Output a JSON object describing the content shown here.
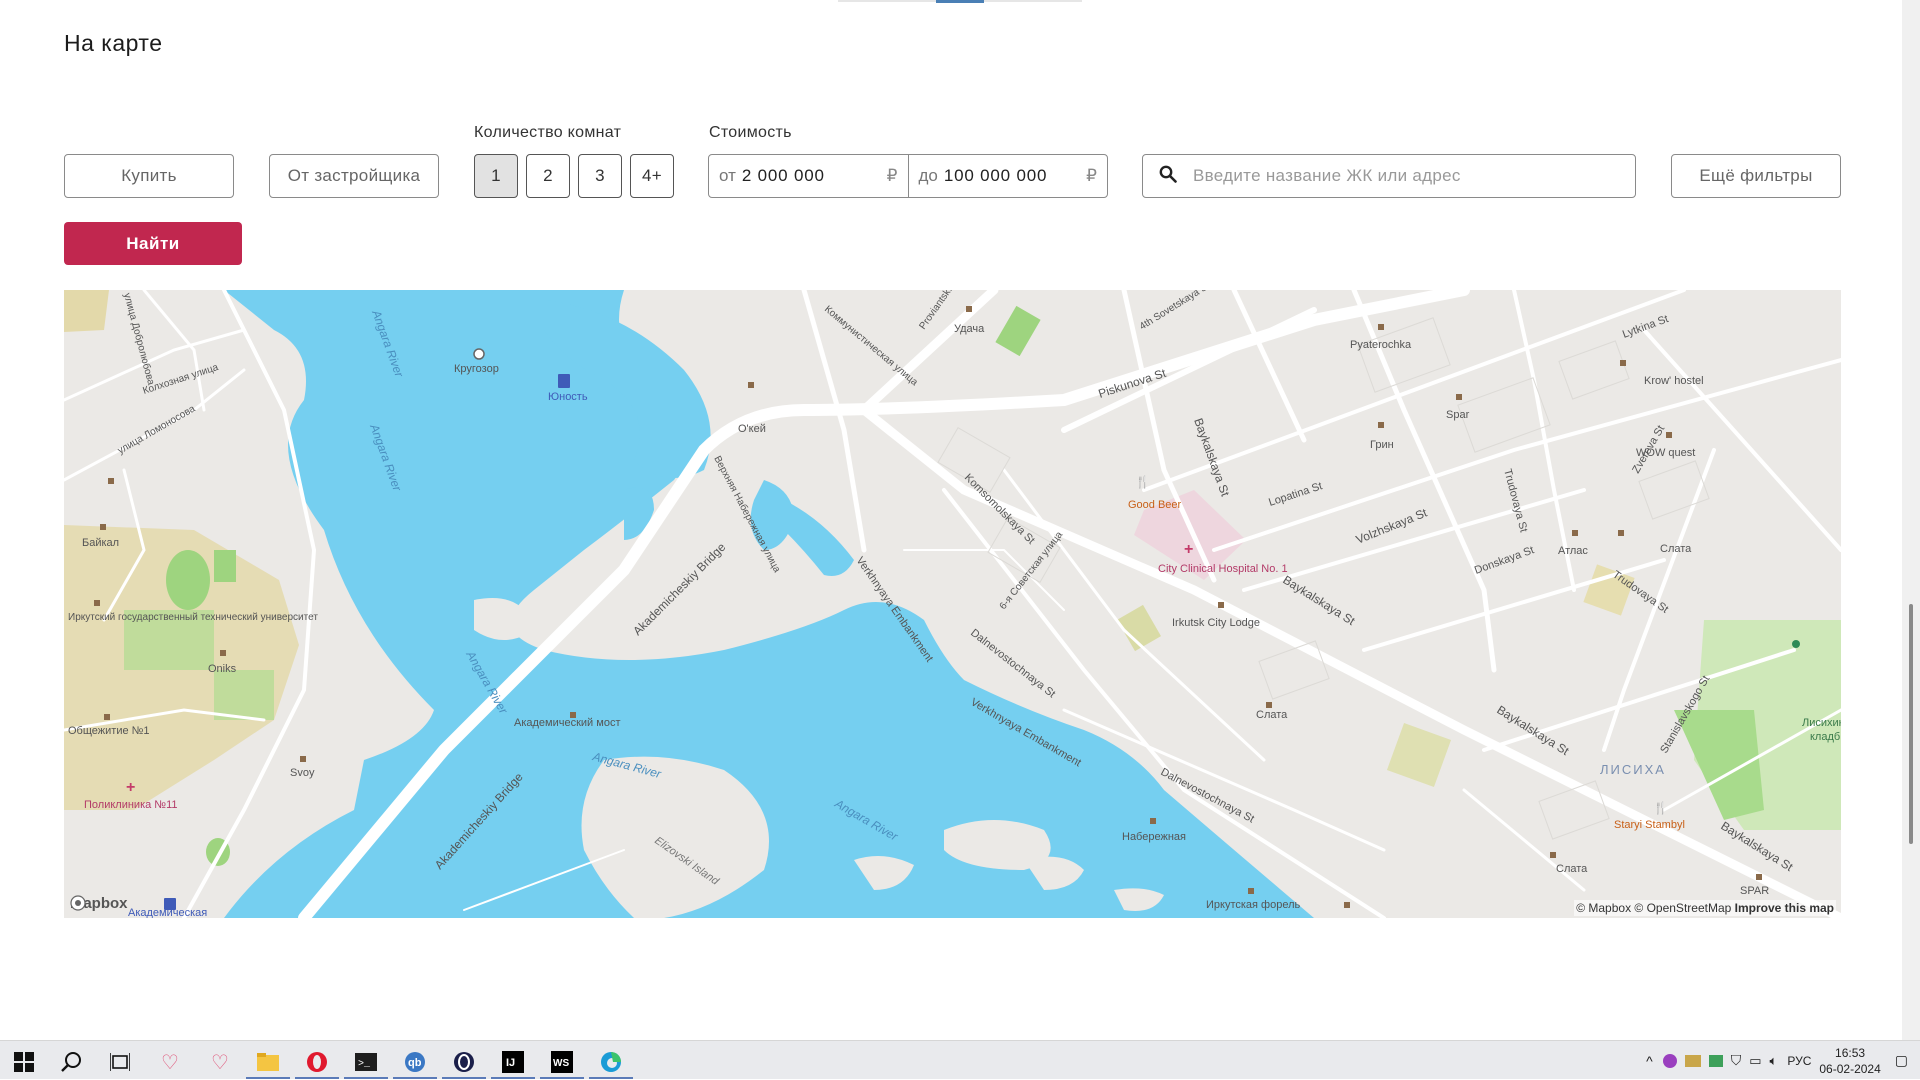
{
  "section_title": "На карте",
  "filters": {
    "deal_type": "Купить",
    "seller": "От застройщика",
    "rooms_label": "Количество комнат",
    "rooms": [
      "1",
      "2",
      "3",
      "4+"
    ],
    "rooms_selected": "1",
    "price_label": "Стоимость",
    "price_from_prefix": "от",
    "price_from": "2 000 000",
    "price_to_prefix": "до",
    "price_to": "100 000 000",
    "currency": "₽",
    "search_placeholder": "Введите название ЖК или адрес",
    "more_filters": "Ещё фильтры",
    "find": "Найти"
  },
  "map": {
    "labels": {
      "angara1": "Angara River",
      "angara2": "Angara River",
      "angara3": "Angara River",
      "angara4": "Angara River",
      "bridge1": "Akademicheskiy Bridge",
      "bridge2": "Akademicheskiy Bridge",
      "most": "Академический мост",
      "elizovski": "Elizovski Island",
      "piskunova": "Piskunova St",
      "baykalskaya1": "Baykalskaya St",
      "baykalskaya2": "Baykalskaya St",
      "baykalskaya3": "Baykalskaya St",
      "baykalskaya4": "Baykalskaya St",
      "lopatina": "Lopatina St",
      "volzhskaya": "Volzhskaya St",
      "donskaya": "Donskaya St",
      "trudovaya1": "Trudovaya St",
      "trudovaya2": "Trudovaya St",
      "zvereva": "Zvereva St",
      "lytkina": "Lytkina St",
      "stanislavskogo": "Stanislavskogo St",
      "komsomolskaya": "Komsomolskaya St",
      "sovetskaya6": "6-я Советская улица",
      "sovetskaya4": "4th Sovetskaya St",
      "dalnevostochnaya1": "Dalnevostochnaya St",
      "dalnevostochnaya2": "Dalnevostochnaya St",
      "verkhnyaya1": "Verkhnyaya Embankment",
      "verkhnyaya2": "Verkhnyaya Embankment",
      "verkhnyaya_ru": "Верхняя Набережная улица",
      "kommun": "Коммунистическая улица",
      "proviantskaya": "Proviantsk...",
      "kolhoz": "Колхозная улица",
      "lomonosova": "улица Ломоносова",
      "dobrolyubova": "улица Добролюбова",
      "krugozor": "Кругозор",
      "yunost": "Юность",
      "okey": "О'кей",
      "udacha": "Удача",
      "pyaterochka": "Pyaterochka",
      "krow": "Krow' hostel",
      "spar1": "Spar",
      "grin": "Грин",
      "wow": "WOW quest",
      "goodbeer": "Good Beer",
      "hospital": "City Clinical Hospital No. 1",
      "lodge": "Irkutsk City Lodge",
      "atlas": "Атлас",
      "slata1": "Слата",
      "slata2": "Слата",
      "slata3": "Слата",
      "baikal": "Байкал",
      "itu": "Иркутский государственный технический университет",
      "oniks": "Oniks",
      "obsh": "Общежитие №1",
      "svoy": "Svoy",
      "poliklinika": "Поликлиника №11",
      "naberezhnaya": "Набережная",
      "forel": "Иркутская форель",
      "lisiha": "ЛИСИХА",
      "staryi": "Staryi Stambyl",
      "spar2": "SPAR",
      "lisihin": "Лисихин",
      "kladb": "кладб",
      "akadem": "Академическая"
    },
    "logo": "mapbox",
    "attribution": "© Mapbox © OpenStreetMap",
    "improve": "Improve this map"
  },
  "taskbar": {
    "time": "16:53",
    "date": "06-02-2024",
    "lang": "РУС"
  },
  "colors": {
    "accent": "#c1274f",
    "water": "#75cff0",
    "land": "#ebe9e6",
    "park": "#c9e6b4"
  }
}
